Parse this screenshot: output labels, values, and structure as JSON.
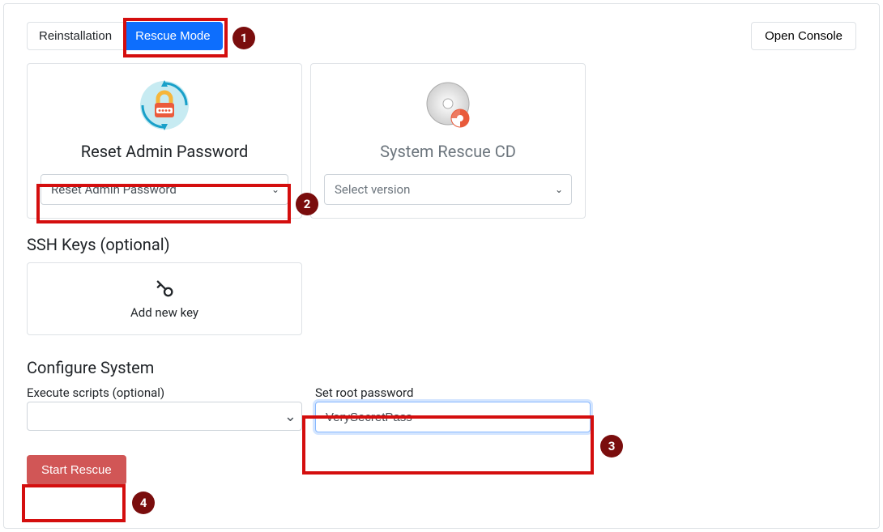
{
  "tabs": {
    "reinstallation": "Reinstallation",
    "rescue_mode": "Rescue Mode"
  },
  "open_console": "Open Console",
  "cards": {
    "reset_password": {
      "title": "Reset Admin Password",
      "select": "Reset Admin Password"
    },
    "rescue_cd": {
      "title": "System Rescue CD",
      "select": "Select version"
    }
  },
  "ssh": {
    "heading": "SSH Keys (optional)",
    "add_label": "Add new key"
  },
  "configure": {
    "heading": "Configure System",
    "execute_label": "Execute scripts (optional)",
    "root_label": "Set root password",
    "root_value": "VerySecretPass"
  },
  "start_button": "Start Rescue",
  "steps": {
    "s1": "1",
    "s2": "2",
    "s3": "3",
    "s4": "4"
  }
}
